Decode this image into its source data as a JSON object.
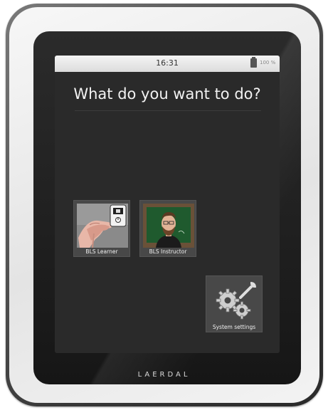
{
  "status_bar": {
    "time": "16:31",
    "battery": "100 %"
  },
  "main": {
    "title": "What do you want to do?"
  },
  "tiles": [
    {
      "label": "BLS Learner"
    },
    {
      "label": "BLS Instructor"
    },
    {
      "label": "System settings"
    }
  ],
  "device": {
    "brand": "LAERDAL"
  },
  "colors": {
    "screen_bg": "#2a2a2a",
    "tile_bg": "#484848",
    "chalkboard": "#1f5a2e"
  }
}
